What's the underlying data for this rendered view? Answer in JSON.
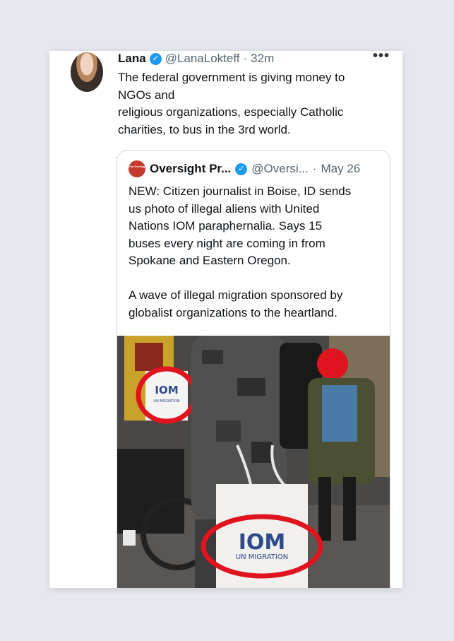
{
  "tweet": {
    "author_name": "Lana",
    "handle": "@LanaLokteff",
    "separator": "·",
    "time": "32m",
    "more": "•••",
    "text_lines": [
      "The federal government is giving money to",
      "NGOs and",
      "religious organizations, especially Catholic",
      "charities, to bus in the 3rd world."
    ]
  },
  "quote": {
    "avatar_text": "The Oversight Project",
    "author_name": "Oversight Pr...",
    "handle": "@Oversi...",
    "separator": "·",
    "date": "May 26",
    "text_lines": [
      "NEW: Citizen journalist in Boise, ID sends",
      "us photo of illegal aliens with United",
      "Nations IOM paraphernalia.  Says 15",
      "buses every night are coming in from",
      "Spokane and Eastern Oregon."
    ],
    "text_lines_2": [
      "A  wave of illegal migration sponsored by",
      "globalist organizations to the heartland."
    ]
  },
  "photo": {
    "bag_small_logo": "IOM",
    "bag_small_sub": "UN MIGRATION",
    "bag_large_logo": "IOM",
    "bag_large_sub": "UN MIGRATION",
    "circle_color": "#e0141e",
    "verified_color": "#1d9bf0"
  }
}
